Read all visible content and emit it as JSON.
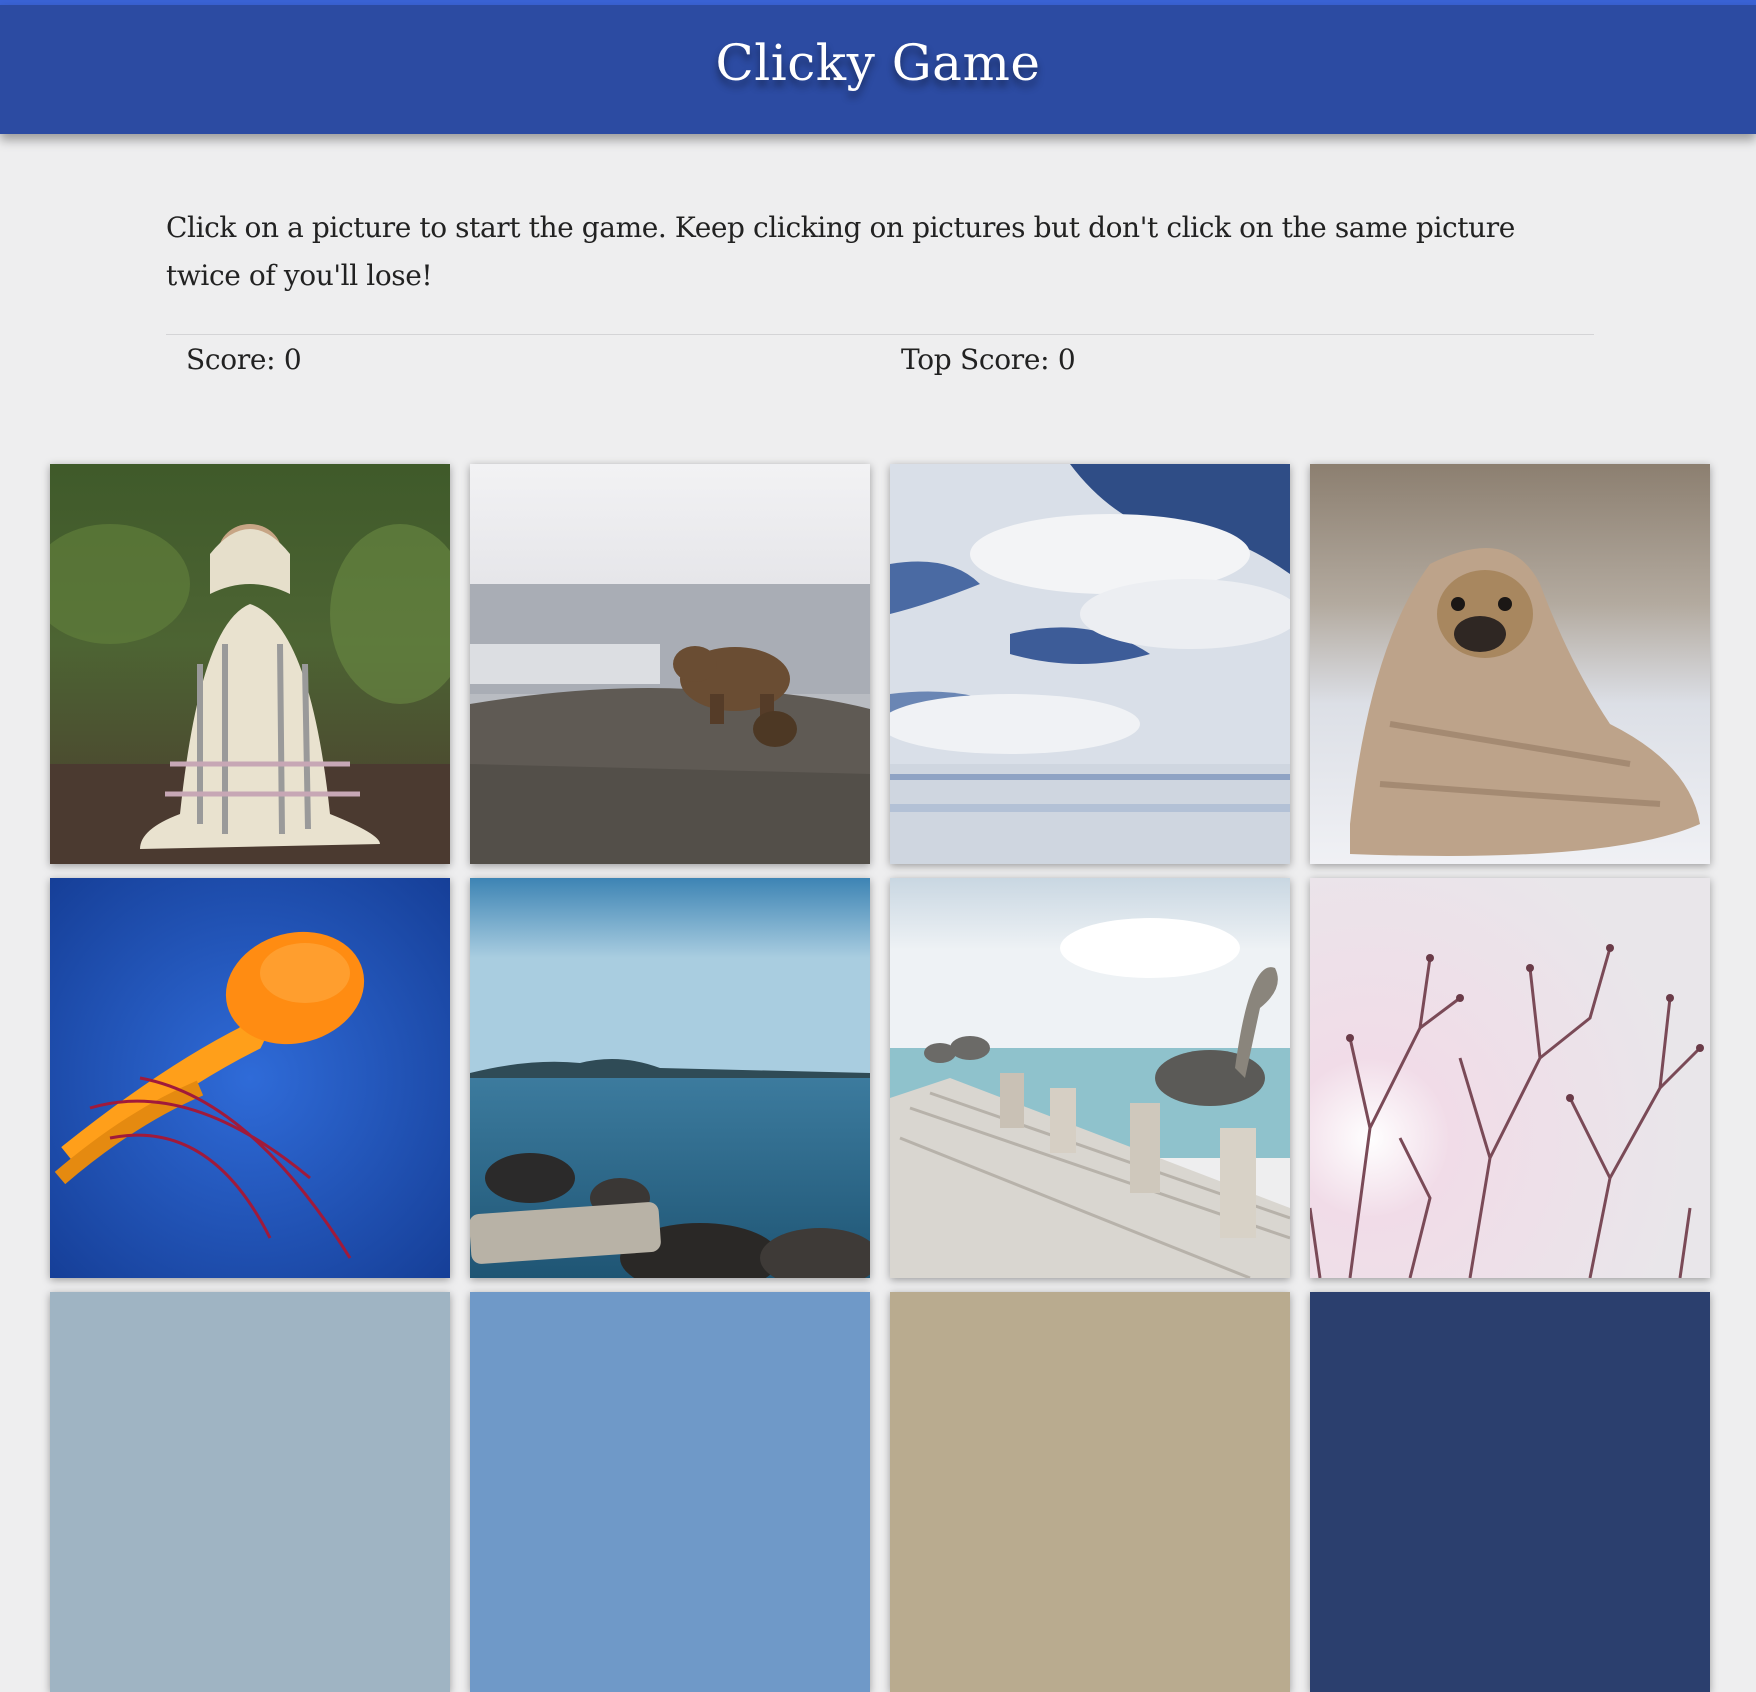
{
  "header": {
    "title": "Clicky Game"
  },
  "intro": {
    "text": "Click on a picture to start the game. Keep clicking on pictures but don't click on the same picture twice of you'll lose!"
  },
  "scores": {
    "score_label": "Score: 0",
    "top_score_label": "Top Score: 0"
  },
  "colors": {
    "header_bg": "#2c4ba2",
    "accent_line": "#3a63d6",
    "page_bg": "#eeeeef"
  },
  "cards": [
    {
      "subject": "pug wrapped in plaid blanket in forest"
    },
    {
      "subject": "brown bear on rocky hillside"
    },
    {
      "subject": "clouds and blue sky"
    },
    {
      "subject": "pug wrapped in beige blanket on bed"
    },
    {
      "subject": "orange jellyfish in blue water"
    },
    {
      "subject": "lake shore with rocks"
    },
    {
      "subject": "pelicans on wooden pier"
    },
    {
      "subject": "bare tree branches with sunlight"
    },
    {
      "subject": "partially visible picture"
    },
    {
      "subject": "partially visible picture"
    },
    {
      "subject": "partially visible picture"
    },
    {
      "subject": "partially visible picture"
    }
  ]
}
